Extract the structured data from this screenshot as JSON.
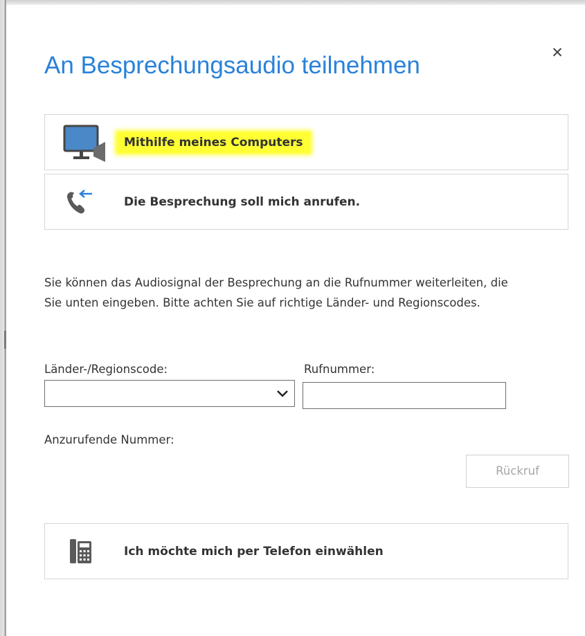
{
  "dialog": {
    "title": "An Besprechungsaudio teilnehmen",
    "close_symbol": "✕",
    "accent_color": "#2a82d8",
    "highlight_color": "#ffff33"
  },
  "options": {
    "computer": {
      "label": "Mithilfe meines Computers",
      "icon": "computer-monitor-icon"
    },
    "call_me": {
      "label": "Die Besprechung soll mich anrufen.",
      "icon": "incoming-call-icon"
    },
    "dial_in": {
      "label": "Ich möchte mich per Telefon einwählen",
      "icon": "desk-phone-icon"
    }
  },
  "callback": {
    "description": "Sie können das Audiosignal der Besprechung an die Rufnummer weiterleiten, die Sie unten eingeben. Bitte achten Sie auf richtige Länder- und Regionscodes.",
    "country_label": "Länder-/Regionscode:",
    "country_value": "",
    "phone_label": "Rufnummer:",
    "phone_value": "",
    "number_to_call_label": "Anzurufende Nummer:",
    "callback_button": "Rückruf"
  }
}
